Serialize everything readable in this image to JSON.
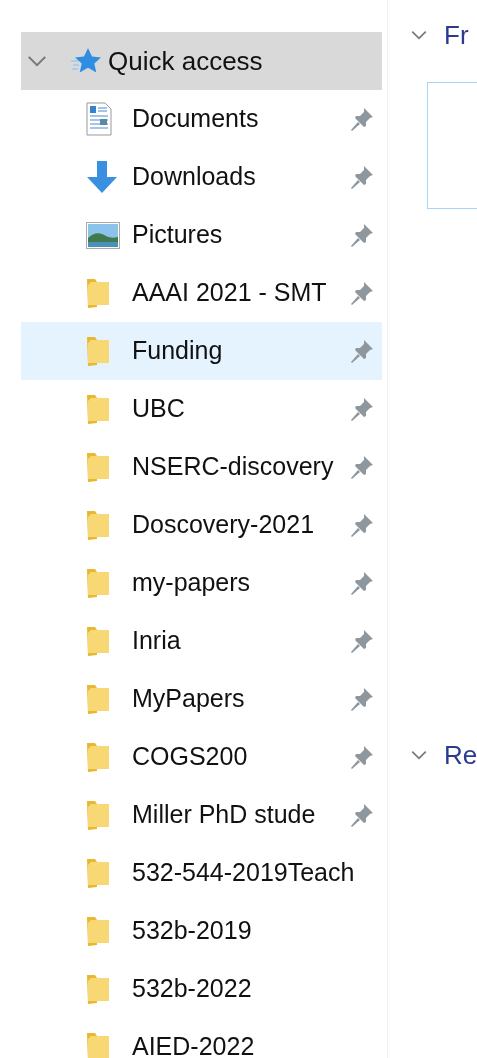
{
  "navigation": {
    "quick_access": {
      "label": "Quick access",
      "expanded": true,
      "selected": true,
      "items": [
        {
          "label": "Documents",
          "kind": "documents",
          "pinned": true,
          "selected": false,
          "hovered": false
        },
        {
          "label": "Downloads",
          "kind": "downloads",
          "pinned": true,
          "selected": false,
          "hovered": false
        },
        {
          "label": "Pictures",
          "kind": "pictures",
          "pinned": true,
          "selected": false,
          "hovered": false
        },
        {
          "label": "AAAI 2021 - SMT",
          "kind": "folder",
          "pinned": true,
          "selected": false,
          "hovered": false
        },
        {
          "label": "Funding",
          "kind": "folder",
          "pinned": true,
          "selected": false,
          "hovered": true
        },
        {
          "label": "UBC",
          "kind": "folder",
          "pinned": true,
          "selected": false,
          "hovered": false
        },
        {
          "label": "NSERC-discovery",
          "kind": "folder",
          "pinned": true,
          "selected": false,
          "hovered": false
        },
        {
          "label": "Doscovery-2021",
          "kind": "folder",
          "pinned": true,
          "selected": false,
          "hovered": false
        },
        {
          "label": "my-papers",
          "kind": "folder",
          "pinned": true,
          "selected": false,
          "hovered": false
        },
        {
          "label": "Inria",
          "kind": "folder",
          "pinned": true,
          "selected": false,
          "hovered": false
        },
        {
          "label": "MyPapers",
          "kind": "folder",
          "pinned": true,
          "selected": false,
          "hovered": false
        },
        {
          "label": "COGS200",
          "kind": "folder",
          "pinned": true,
          "selected": false,
          "hovered": false
        },
        {
          "label": "Miller PhD stude",
          "kind": "folder",
          "pinned": true,
          "selected": false,
          "hovered": false
        },
        {
          "label": "532-544-2019Teach",
          "kind": "folder",
          "pinned": false,
          "selected": false,
          "hovered": false
        },
        {
          "label": "532b-2019",
          "kind": "folder",
          "pinned": false,
          "selected": false,
          "hovered": false
        },
        {
          "label": "532b-2022",
          "kind": "folder",
          "pinned": false,
          "selected": false,
          "hovered": false
        },
        {
          "label": "AIED-2022",
          "kind": "folder",
          "pinned": false,
          "selected": false,
          "hovered": false
        }
      ]
    }
  },
  "content": {
    "sections": [
      {
        "title": "Fr",
        "expanded": true
      },
      {
        "title": "Re",
        "expanded": true
      }
    ]
  }
}
